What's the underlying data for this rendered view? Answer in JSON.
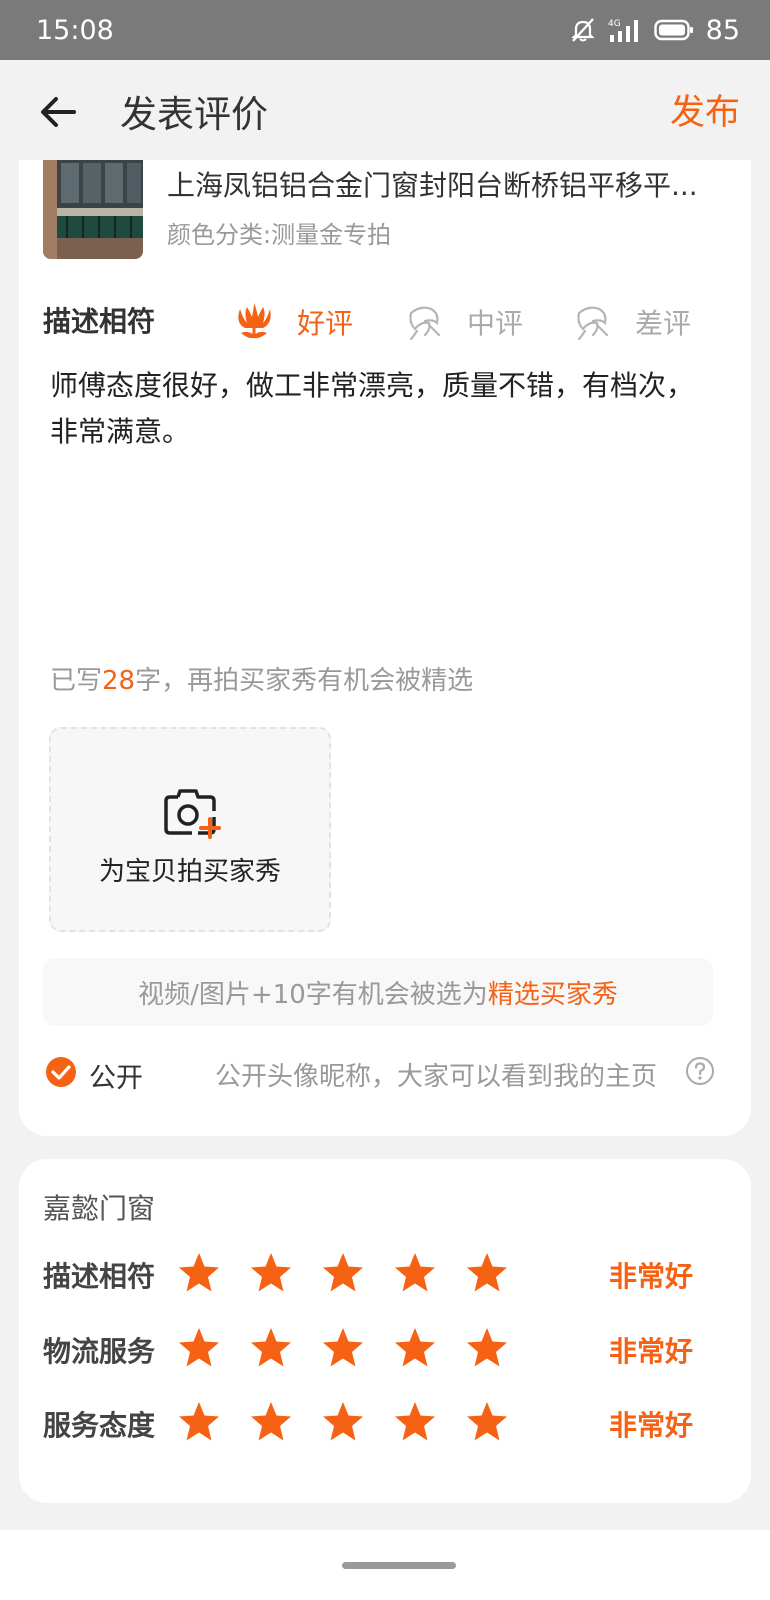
{
  "status_bar": {
    "time": "15:08",
    "network": "4G",
    "battery": "85"
  },
  "nav": {
    "title": "发表评价",
    "publish_label": "发布"
  },
  "product": {
    "title": "上海凤铝铝合金门窗封阳台断桥铝平移平...",
    "sku": "颜色分类:测量金专拍"
  },
  "rating": {
    "label": "描述相符",
    "options": [
      {
        "label": "好评",
        "selected": true,
        "icon": "tulip-icon"
      },
      {
        "label": "中评",
        "selected": false,
        "icon": "flower-outline-icon"
      },
      {
        "label": "差评",
        "selected": false,
        "icon": "flower-outline-icon"
      }
    ]
  },
  "review": {
    "text": "师傅态度很好，做工非常漂亮，质量不错，有档次，非常满意。",
    "count_prefix": "已写",
    "count": "28",
    "count_suffix": "字，再拍买家秀有机会被精选"
  },
  "photo": {
    "label": "为宝贝拍买家秀",
    "icon": "camera-add-icon"
  },
  "tip": {
    "text": "视频/图片+10字有机会被选为",
    "highlight": "精选买家秀"
  },
  "privacy": {
    "checked": true,
    "label": "公开",
    "description": "公开头像昵称，大家可以看到我的主页",
    "help_icon": "question-icon"
  },
  "shop": {
    "name": "嘉懿门窗",
    "scores": [
      {
        "label": "描述相符",
        "stars": 5,
        "text": "非常好"
      },
      {
        "label": "物流服务",
        "stars": 5,
        "text": "非常好"
      },
      {
        "label": "服务态度",
        "stars": 5,
        "text": "非常好"
      }
    ]
  },
  "colors": {
    "accent": "#f56214",
    "background": "#f2f2f2",
    "status_bar": "#7a7a7a"
  }
}
